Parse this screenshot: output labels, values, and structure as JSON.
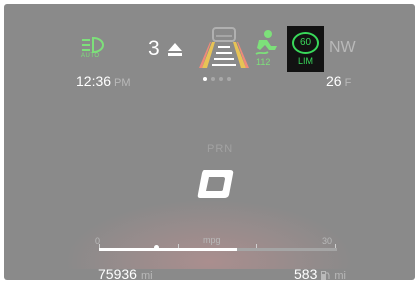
{
  "status_bar": {
    "headlight_icon": "auto-headlight-icon",
    "headlight_label": "AUTO",
    "gear_indicator": "3",
    "upshift_icon": "upshift-arrow-icon",
    "lane_icon": "lane-keep-icon",
    "assist_icon": "traction-control-icon",
    "assist_value": "112",
    "speed_limit_value": "60",
    "speed_limit_label": "LIM",
    "compass": "NW"
  },
  "info_row": {
    "time": "12:36",
    "time_period": "PM",
    "page_count": 4,
    "active_page": 0,
    "temperature": "26",
    "temperature_unit": "F"
  },
  "center": {
    "transmission_label": "PRN",
    "gear_display": "D"
  },
  "economy_bar": {
    "min_label": "0",
    "max_label": "30",
    "unit_label": "mpg",
    "current_fraction": 0.58,
    "average_fraction": 0.24
  },
  "bottom_row": {
    "odometer": "75936",
    "odometer_unit": "mi",
    "range": "583",
    "range_unit": "mi",
    "fuel_icon": "fuel-pump-icon"
  },
  "colors": {
    "accent_green": "#7de07a",
    "limit_green": "#39d85a",
    "background": "#8a8a8a"
  }
}
